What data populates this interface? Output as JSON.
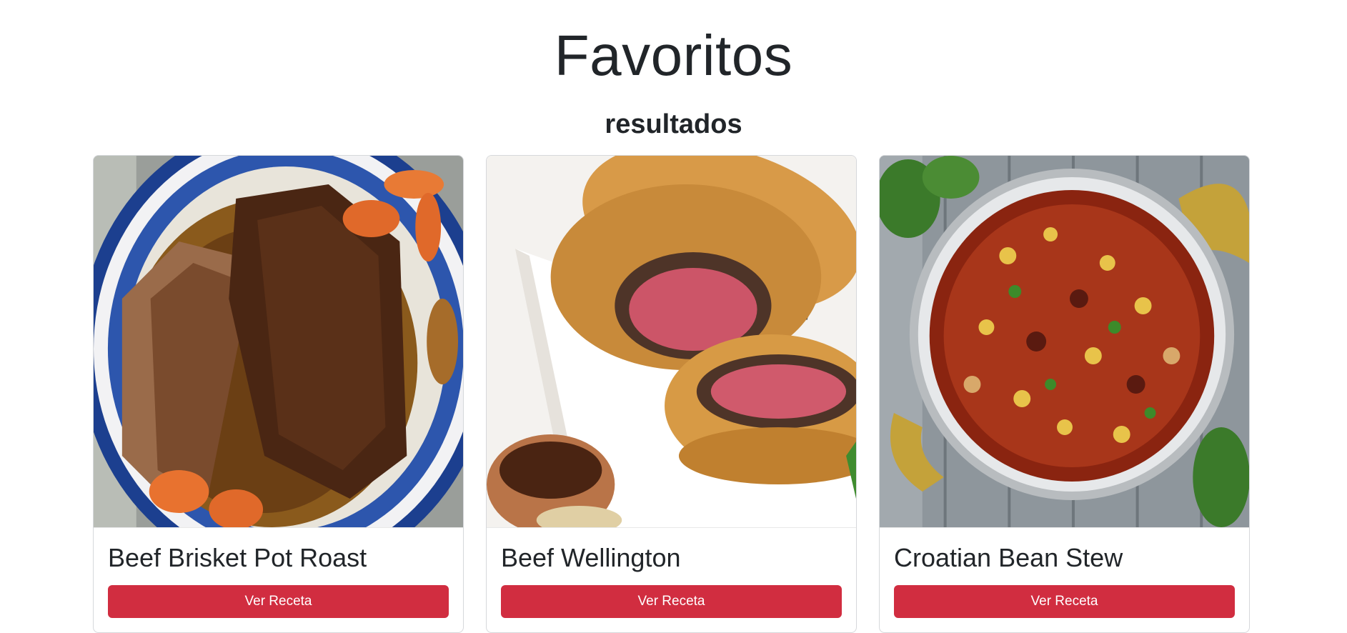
{
  "page": {
    "title": "Favoritos",
    "subtitle": "resultados"
  },
  "colors": {
    "button_bg": "#d12d40",
    "button_text": "#ffffff",
    "text": "#212529",
    "card_border": "#d6d8db"
  },
  "cards": [
    {
      "title": "Beef Brisket Pot Roast",
      "button_label": "Ver Receta",
      "image_icon": "beef-brisket-photo"
    },
    {
      "title": "Beef Wellington",
      "button_label": "Ver Receta",
      "image_icon": "beef-wellington-photo"
    },
    {
      "title": "Croatian Bean Stew",
      "button_label": "Ver Receta",
      "image_icon": "bean-stew-photo"
    }
  ]
}
